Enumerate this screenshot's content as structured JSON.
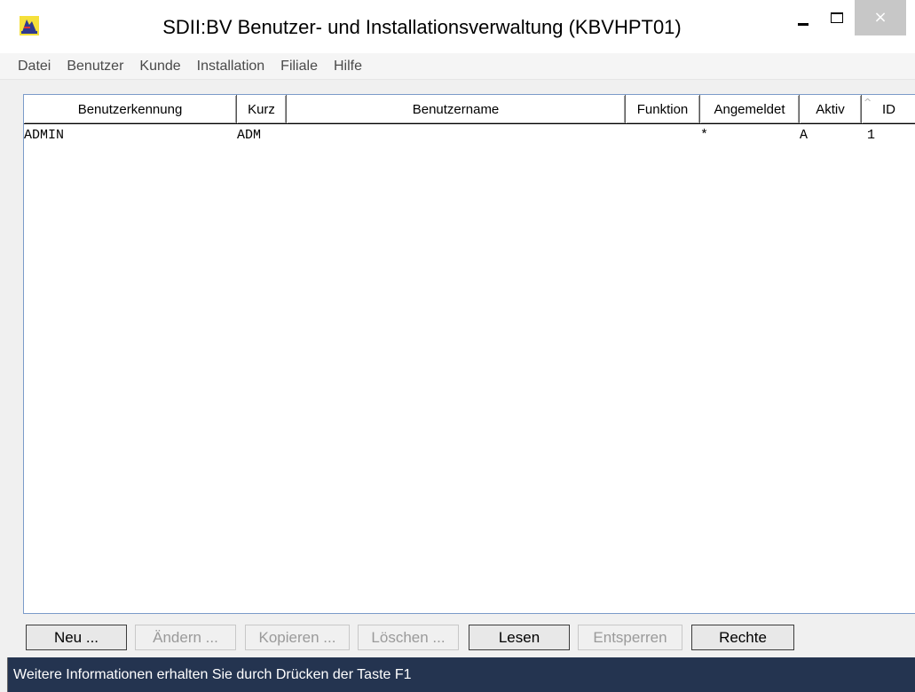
{
  "window": {
    "title": "SDII:BV Benutzer- und Installationsverwaltung (KBVHPT01)",
    "close_symbol": "×"
  },
  "menu": [
    "Datei",
    "Benutzer",
    "Kunde",
    "Installation",
    "Filiale",
    "Hilfe"
  ],
  "table": {
    "columns": [
      "Benutzerkennung",
      "Kurz",
      "Benutzername",
      "Funktion",
      "Angemeldet",
      "Aktiv",
      "ID"
    ],
    "sort_indicator": "^",
    "rows": [
      [
        "ADMIN",
        "ADM",
        "",
        "",
        "*",
        "A",
        "1"
      ]
    ]
  },
  "buttons": {
    "neu": "Neu ...",
    "aendern": "Ändern ...",
    "kopieren": "Kopieren ...",
    "loeschen": "Löschen ...",
    "lesen": "Lesen",
    "entsperren": "Entsperren",
    "rechte": "Rechte"
  },
  "status": "Weitere Informationen erhalten Sie durch Drücken der Taste F1",
  "icons": {
    "app": "app-icon",
    "minimize": "minimize-icon",
    "maximize": "maximize-icon",
    "close": "close-icon"
  },
  "colors": {
    "statusbar": "#243450",
    "close_button": "#c7c7c7",
    "list_border": "#7b9bc9"
  }
}
